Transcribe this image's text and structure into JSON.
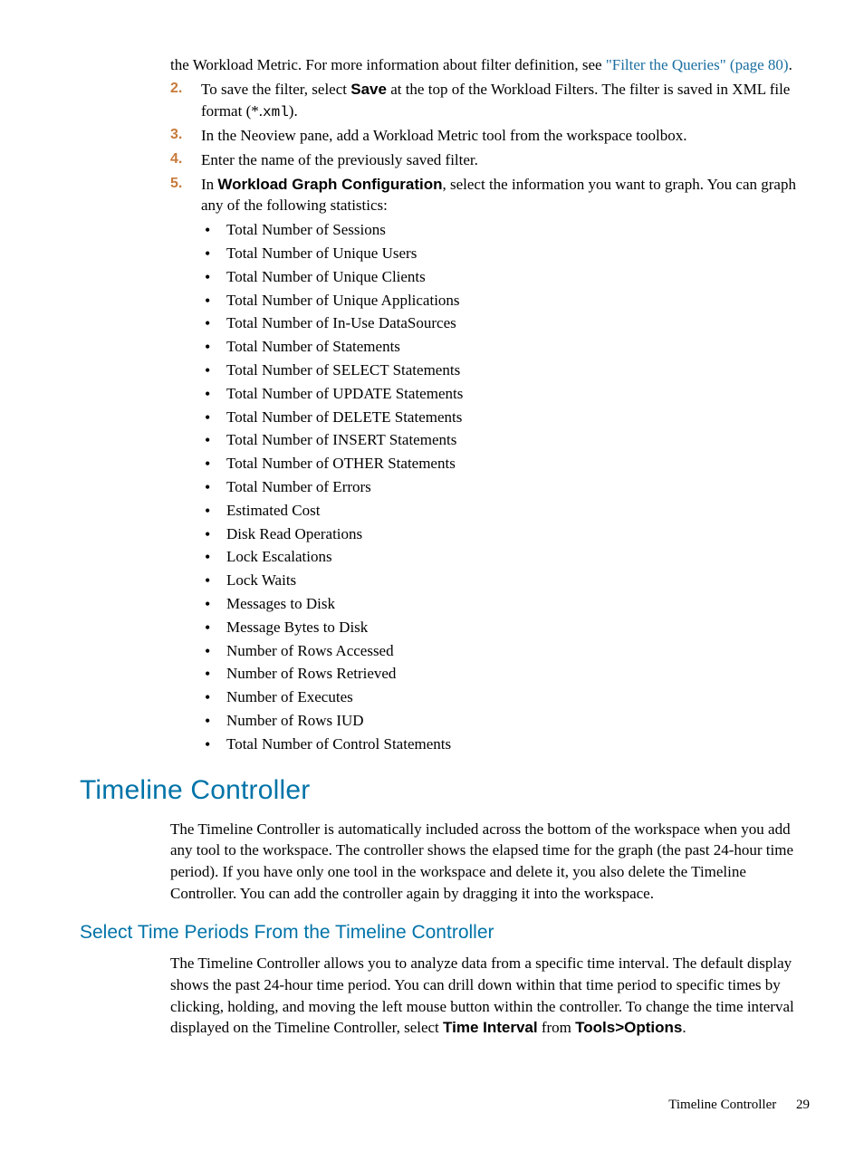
{
  "intro": {
    "top_text_1": "the Workload Metric. For more information about filter definition, see ",
    "link_text": "\"Filter the Queries\" (page 80)",
    "top_text_2": "."
  },
  "steps": {
    "s2": {
      "num": "2.",
      "pre": "To save the filter, select ",
      "bold": "Save",
      "post": " at the top of the Workload Filters. The filter is saved in XML file format (*.",
      "mono": "xml",
      "post2": ")."
    },
    "s3": {
      "num": "3.",
      "text": "In the Neoview pane, add a Workload Metric tool from the workspace toolbox."
    },
    "s4": {
      "num": "4.",
      "text": "Enter the name of the previously saved filter."
    },
    "s5": {
      "num": "5.",
      "pre": "In ",
      "bold": "Workload Graph Configuration",
      "post": ", select the information you want to graph. You can graph any of the following statistics:"
    }
  },
  "bullets": [
    "Total Number of Sessions",
    "Total Number of Unique Users",
    "Total Number of Unique Clients",
    "Total Number of Unique Applications",
    "Total Number of In-Use DataSources",
    "Total Number of Statements",
    "Total Number of SELECT Statements",
    "Total Number of UPDATE Statements",
    "Total Number of DELETE Statements",
    "Total Number of INSERT Statements",
    "Total Number of OTHER Statements",
    "Total Number of Errors",
    "Estimated Cost",
    "Disk Read Operations",
    "Lock Escalations",
    "Lock Waits",
    "Messages to Disk",
    "Message Bytes to Disk",
    "Number of Rows Accessed",
    "Number of Rows Retrieved",
    "Number of Executes",
    "Number of Rows IUD",
    "Total Number of Control Statements"
  ],
  "section1": {
    "heading": "Timeline Controller",
    "para": "The Timeline Controller is automatically included across the bottom of the workspace when you add any tool to the workspace. The controller shows the elapsed time for the graph (the past 24-hour time period). If you have only one tool in the workspace and delete it, you also delete the Timeline Controller. You can add the controller again by dragging it into the workspace."
  },
  "section2": {
    "heading": "Select Time Periods From the Timeline Controller",
    "para_pre": "The Timeline Controller allows you to analyze data from a specific time interval. The default display shows the past 24-hour time period. You can drill down within that time period to specific times by clicking, holding, and moving the left mouse button within the controller. To change the time interval displayed on the Timeline Controller, select ",
    "bold1": "Time Interval",
    "mid": " from ",
    "bold2": "Tools>Options",
    "post": "."
  },
  "footer": {
    "label": "Timeline Controller",
    "page": "29"
  }
}
